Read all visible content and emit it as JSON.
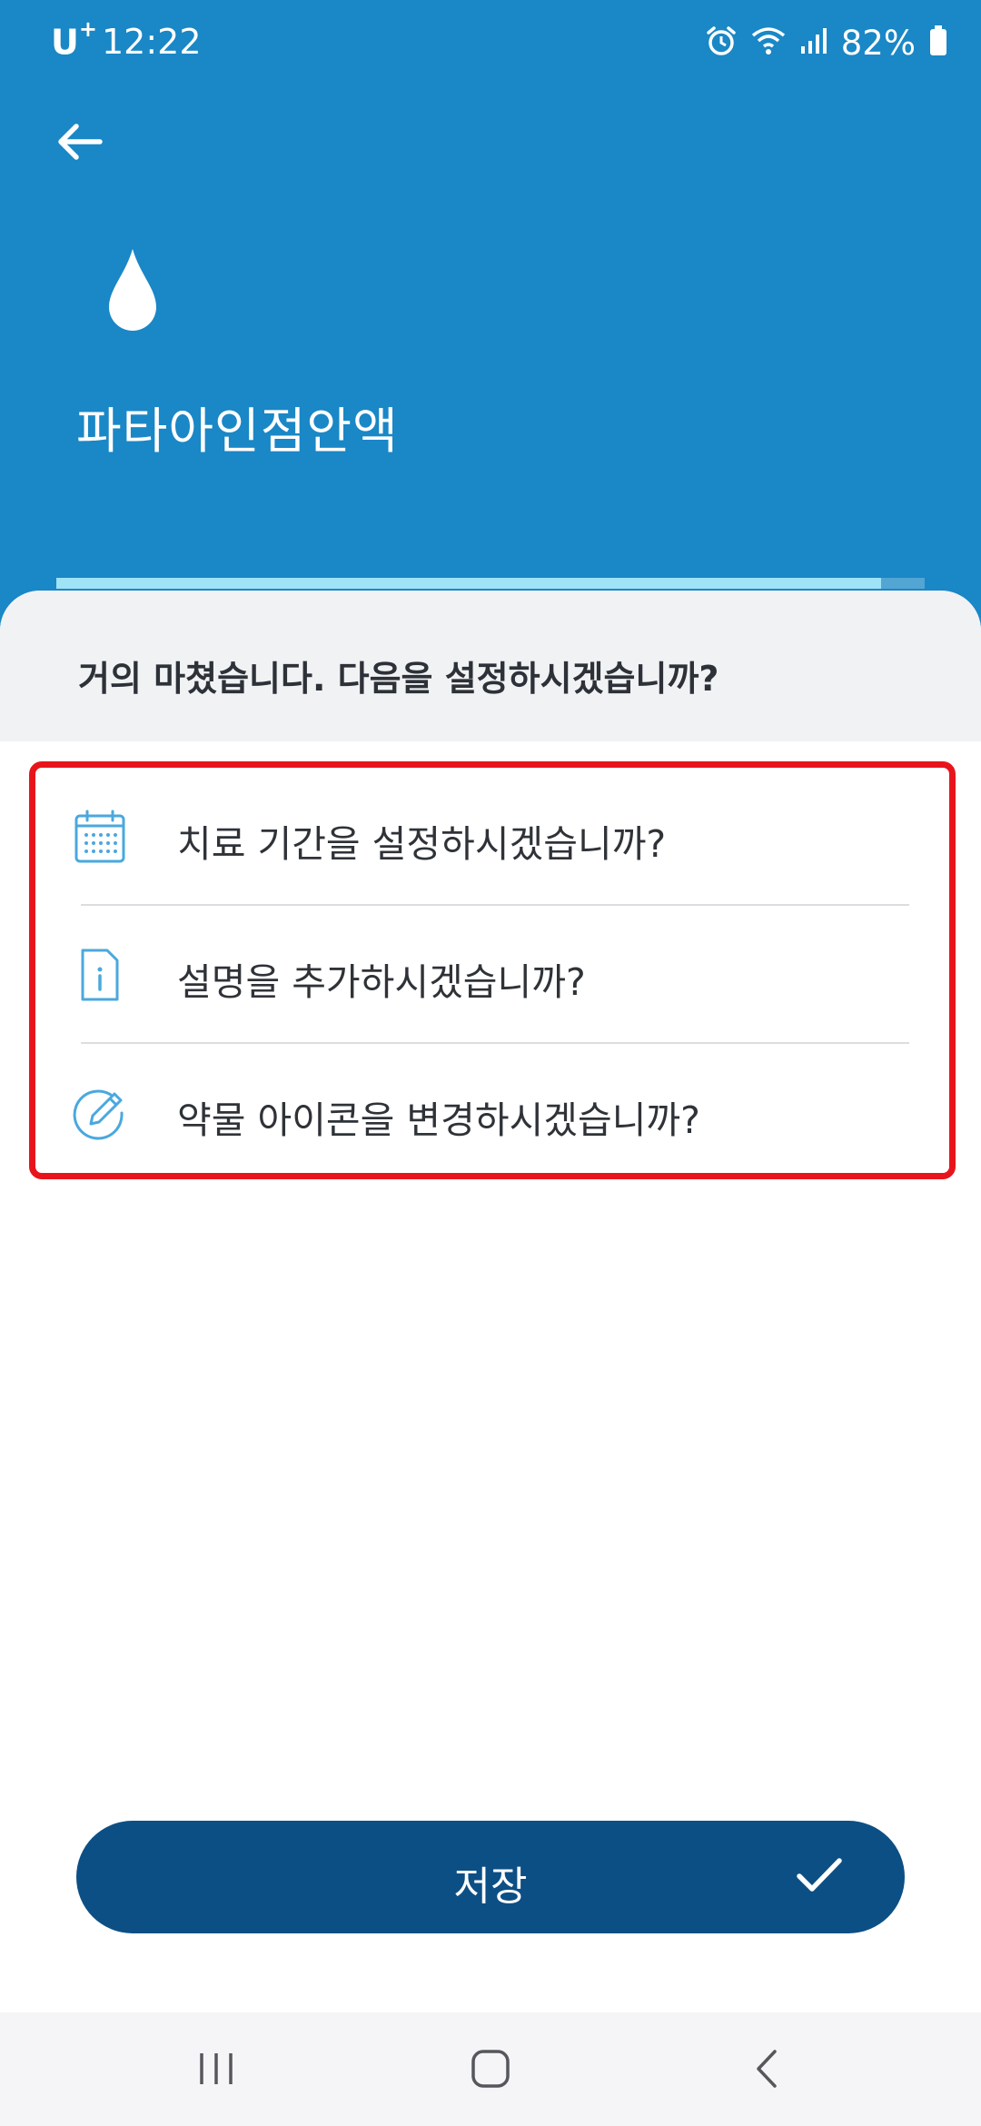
{
  "status_bar": {
    "carrier": "U",
    "carrier_sup": "+",
    "time": "12:22",
    "battery": "82%",
    "icons": [
      "alarm-icon",
      "wifi-icon",
      "signal-icon",
      "battery-icon"
    ]
  },
  "header": {
    "back_icon": "back-arrow-icon",
    "medication_icon": "drop-icon",
    "medication_name": "파타아인점안액",
    "progress": 0.95,
    "background_color": "#1a87c6"
  },
  "sheet": {
    "heading": "거의 마쳤습니다. 다음을 설정하시겠습니까?",
    "options": [
      {
        "icon": "calendar-icon",
        "label": "치료 기간을 설정하시겠습니까?"
      },
      {
        "icon": "info-document-icon",
        "label": "설명을 추가하시겠습니까?"
      },
      {
        "icon": "edit-pencil-icon",
        "label": "약물 아이콘을 변경하시겠습니까?"
      }
    ],
    "highlight_color": "#e8141c",
    "icon_color": "#4aa8de"
  },
  "save_button": {
    "label": "저장",
    "icon": "check-icon",
    "color": "#0c4f85"
  },
  "nav_bar": {
    "items": [
      "recent-apps-icon",
      "home-icon",
      "back-icon"
    ]
  }
}
